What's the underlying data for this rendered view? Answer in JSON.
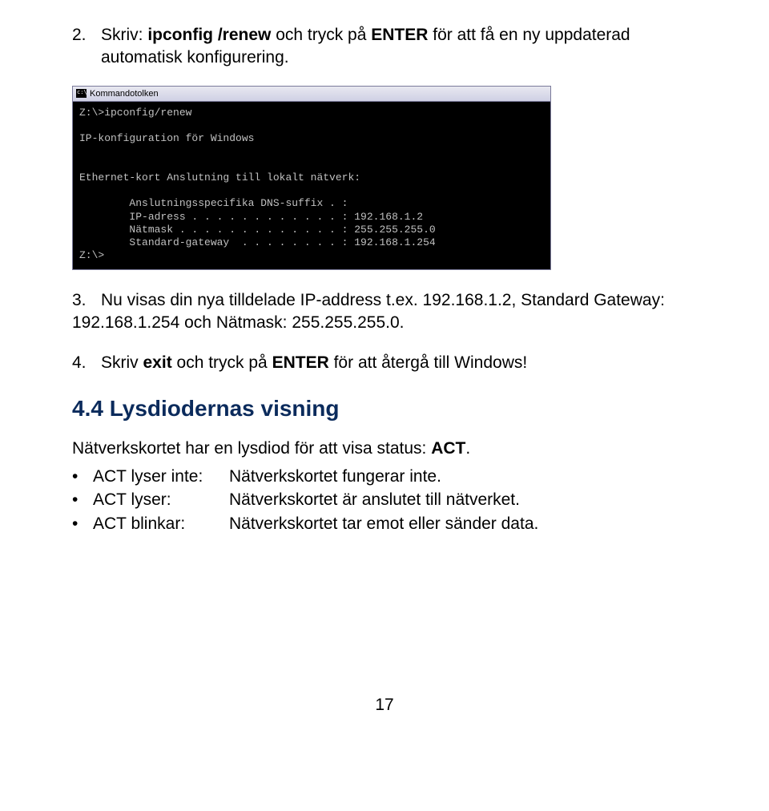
{
  "steps": {
    "step2": {
      "num": "2.",
      "pre": "Skriv: ",
      "cmd": "ipconfig /renew",
      "mid": " och tryck på ",
      "enter": "ENTER",
      "post": " för att få en ny uppdaterad automatisk konfigurering."
    },
    "step3": {
      "num": "3.",
      "text": "Nu visas din nya tilldelade IP-address t.ex. 192.168.1.2, Standard Gateway: 192.168.1.254 och Nätmask: 255.255.255.0."
    },
    "step4": {
      "num": "4.",
      "pre": "Skriv ",
      "cmd": "exit",
      "mid": " och tryck på ",
      "enter": "ENTER",
      "post": " för att återgå till Windows!"
    }
  },
  "terminal": {
    "title": "Kommandotolken",
    "line1": "Z:\\>ipconfig/renew",
    "line3": "IP-konfiguration för Windows",
    "line5": "Ethernet-kort Anslutning till lokalt nätverk:",
    "line7": "        Anslutningsspecifika DNS-suffix . :",
    "line8": "        IP-adress . . . . . . . . . . . . : 192.168.1.2",
    "line9": "        Nätmask . . . . . . . . . . . . . : 255.255.255.0",
    "line10": "        Standard-gateway  . . . . . . . . : 192.168.1.254",
    "line11": "Z:\\>"
  },
  "section": {
    "title": "4.4 Lysdiodernas visning",
    "intro_pre": "Nätverkskortet har en lysdiod för att visa status: ",
    "intro_bold": "ACT",
    "intro_post": "."
  },
  "bullets": {
    "b1": {
      "dot": "•",
      "label": "ACT lyser inte:",
      "desc": "Nätverkskortet fungerar inte."
    },
    "b2": {
      "dot": "•",
      "label": "ACT lyser:",
      "desc": "Nätverkskortet är anslutet till nätverket."
    },
    "b3": {
      "dot": "•",
      "label": "ACT blinkar:",
      "desc": "Nätverkskortet tar emot eller sänder data."
    }
  },
  "page_number": "17"
}
